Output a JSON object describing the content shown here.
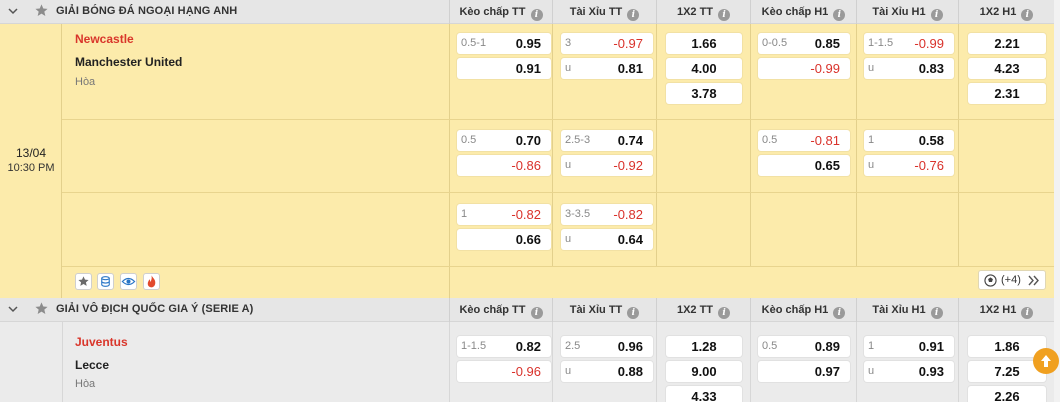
{
  "column_headers": [
    "Kèo chấp TT",
    "Tài Xỉu TT",
    "1X2 TT",
    "Kèo chấp H1",
    "Tài Xỉu H1",
    "1X2 H1"
  ],
  "leagues": [
    {
      "name": "GIẢI BÓNG ĐÁ NGOẠI HẠNG ANH",
      "match": {
        "date": "13/04",
        "time": "10:30 PM",
        "home": "Newcastle",
        "away": "Manchester United",
        "draw": "Hòa",
        "rows": [
          {
            "hc_tt": {
              "line": "0.5-1",
              "home": "0.95",
              "away": "0.91"
            },
            "ou_tt": {
              "line": "3",
              "over": "-0.97",
              "under_label": "u",
              "under": "0.81"
            },
            "x12_tt": [
              "1.66",
              "4.00",
              "3.78"
            ],
            "hc_h1": {
              "line": "0-0.5",
              "home": "0.85",
              "away": "-0.99"
            },
            "ou_h1": {
              "line": "1-1.5",
              "over": "-0.99",
              "under_label": "u",
              "under": "0.83"
            },
            "x12_h1": [
              "2.21",
              "4.23",
              "2.31"
            ]
          },
          {
            "hc_tt": {
              "line": "0.5",
              "home": "0.70",
              "away": "-0.86"
            },
            "ou_tt": {
              "line": "2.5-3",
              "over": "0.74",
              "under_label": "u",
              "under": "-0.92"
            },
            "hc_h1": {
              "line": "0.5",
              "home": "-0.81",
              "away": "0.65"
            },
            "ou_h1": {
              "line": "1",
              "over": "0.58",
              "under_label": "u",
              "under": "-0.76"
            }
          },
          {
            "hc_tt": {
              "line": "1",
              "home": "-0.82",
              "away": "0.66"
            },
            "ou_tt": {
              "line": "3-3.5",
              "over": "-0.82",
              "under_label": "u",
              "under": "0.64"
            }
          }
        ],
        "more_label": "(+4)",
        "icons": [
          "star-icon",
          "stats-icon",
          "eye-icon",
          "fire-icon"
        ]
      }
    },
    {
      "name": "GIẢI VÔ ĐỊCH QUỐC GIA Ý (SERIE A)",
      "match": {
        "home": "Juventus",
        "away": "Lecce",
        "draw": "Hòa",
        "rows": [
          {
            "hc_tt": {
              "line": "1-1.5",
              "home": "0.82",
              "away": "-0.96"
            },
            "ou_tt": {
              "line": "2.5",
              "over": "0.96",
              "under_label": "u",
              "under": "0.88"
            },
            "x12_tt": [
              "1.28",
              "9.00",
              "4.33"
            ],
            "hc_h1": {
              "line": "0.5",
              "home": "0.89",
              "away": "0.97"
            },
            "ou_h1": {
              "line": "1",
              "over": "0.91",
              "under_label": "u",
              "under": "0.93"
            },
            "x12_h1": [
              "1.86",
              "7.25",
              "2.26"
            ]
          }
        ]
      }
    }
  ],
  "colors": {
    "header_bg": "#e6e6e6",
    "live_row_bg": "#fcebab",
    "row_bg": "#ebebeb",
    "home_team": "#d9362b",
    "negative_odds": "#d9322b",
    "scroll_top": "#f0a020"
  }
}
